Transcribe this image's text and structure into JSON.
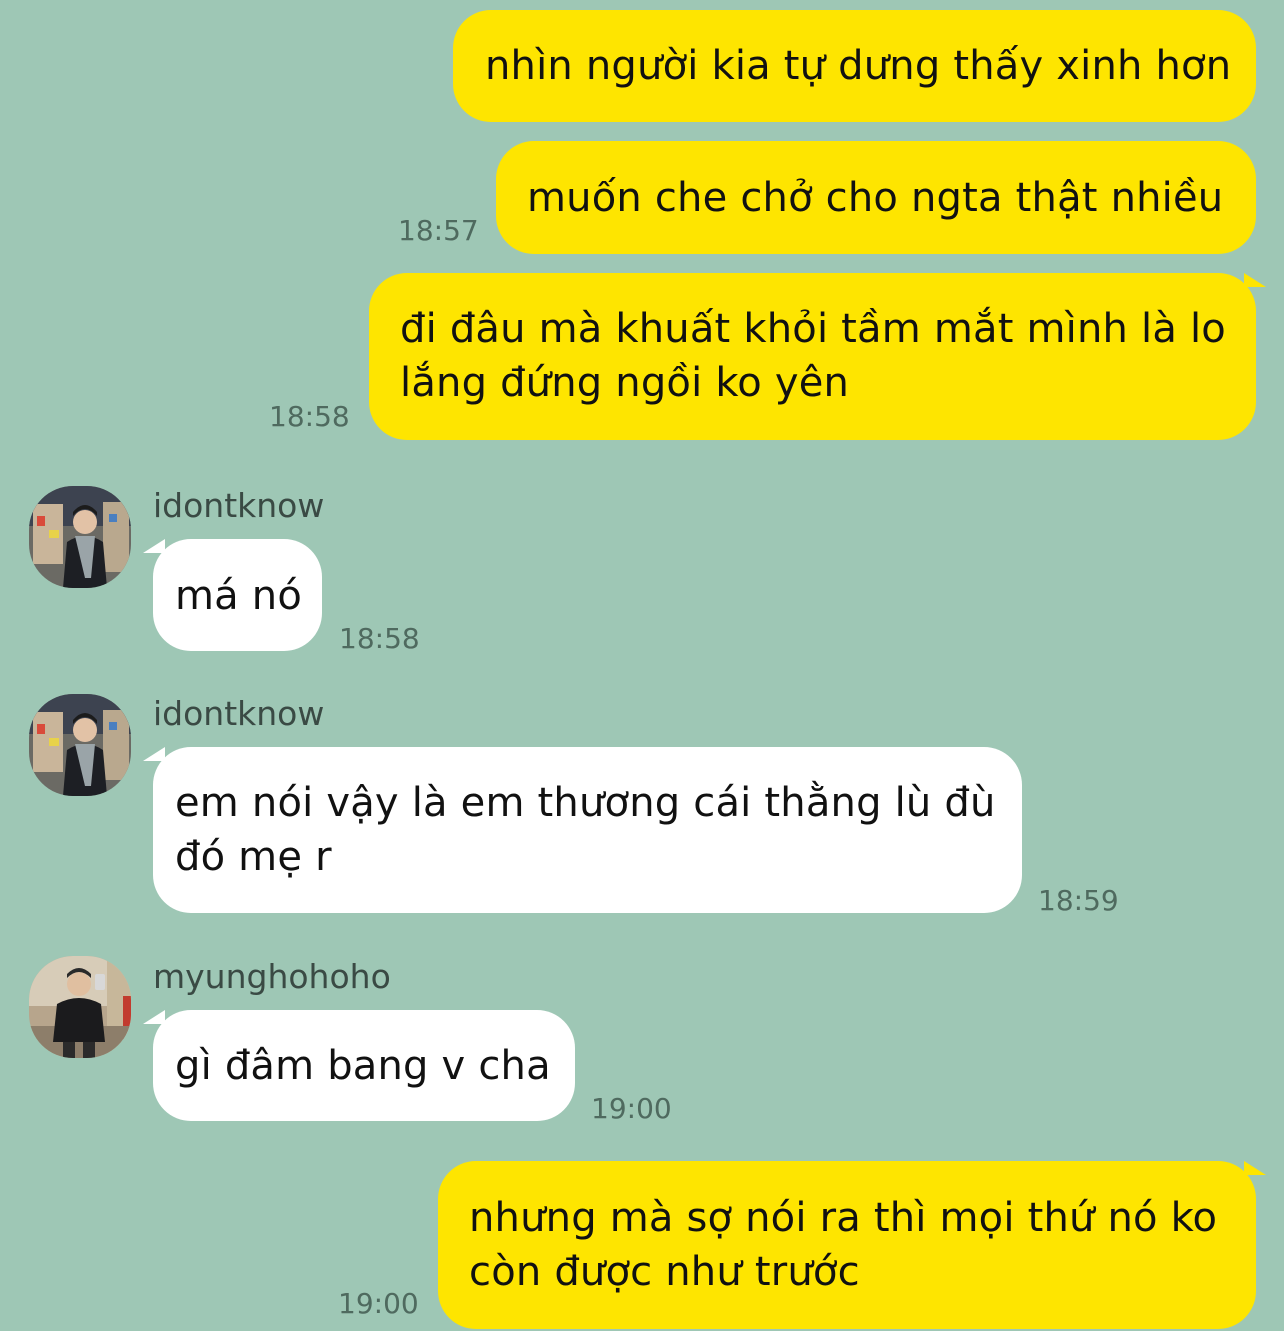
{
  "messages": [
    {
      "sender": "me",
      "text": "nhìn người kia tự dưng thấy xinh hơn",
      "time": ""
    },
    {
      "sender": "me",
      "text": "muốn che chở cho ngta thật nhiều",
      "time": "18:57"
    },
    {
      "sender": "me",
      "lines": [
        "đi đâu mà khuất khỏi tầm mắt mình là lo",
        "lắng đứng ngồi ko yên"
      ],
      "time": "18:58"
    },
    {
      "sender": "idontknow",
      "text": "má nó",
      "time": "18:58"
    },
    {
      "sender": "idontknow",
      "lines": [
        "em nói vậy là em thương cái thằng lù đù",
        "đó mẹ r"
      ],
      "time": "18:59"
    },
    {
      "sender": "myunghohoho",
      "text": "gì đâm bang v cha",
      "time": "19:00"
    },
    {
      "sender": "me",
      "lines": [
        "nhưng mà sợ nói ra thì mọi thứ nó ko",
        "còn được như trước"
      ],
      "time": "19:00"
    }
  ],
  "users": {
    "u1": {
      "name": "idontknow",
      "avatar_icon": "profile-photo-icon"
    },
    "u2": {
      "name": "myunghohoho",
      "avatar_icon": "profile-photo-icon"
    }
  },
  "colors": {
    "background": "#9ec7b5",
    "my_bubble": "#fee500",
    "their_bubble": "#ffffff"
  }
}
